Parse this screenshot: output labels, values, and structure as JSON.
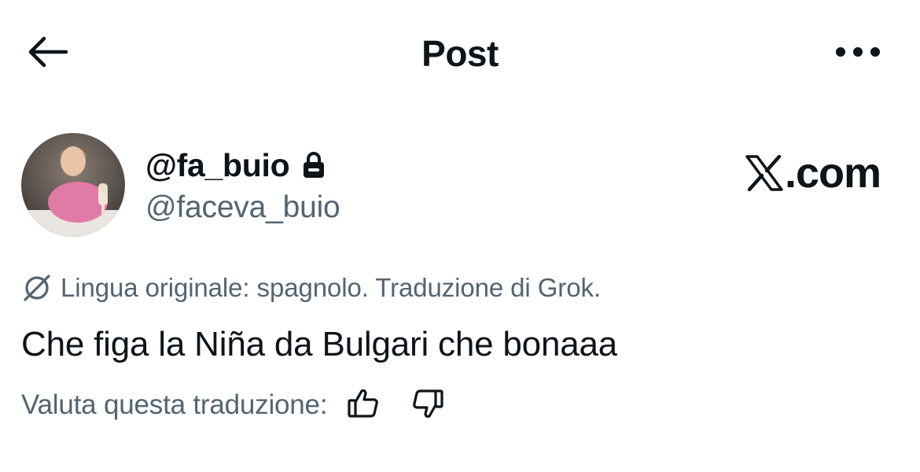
{
  "header": {
    "title": "Post",
    "back_icon": "arrow-left-icon",
    "more_icon": "more-horizontal-icon"
  },
  "author": {
    "display_name": "@fa_buio",
    "handle": "@faceva_buio",
    "protected_icon": "lock-icon",
    "avatar_icon": "avatar"
  },
  "brand": {
    "logo_icon": "x-logo-icon",
    "domain": ".com"
  },
  "translation": {
    "icon": "translate-icon",
    "notice": "Lingua originale: spagnolo. Traduzione di Grok."
  },
  "post": {
    "text": "Che figa la Niña da Bulgari che bonaaa"
  },
  "rating": {
    "label": "Valuta questa traduzione:",
    "thumbs_up_icon": "thumbs-up-icon",
    "thumbs_down_icon": "thumbs-down-icon"
  },
  "colors": {
    "primary_text": "#0f1419",
    "secondary_text": "#536471",
    "background": "#ffffff"
  }
}
